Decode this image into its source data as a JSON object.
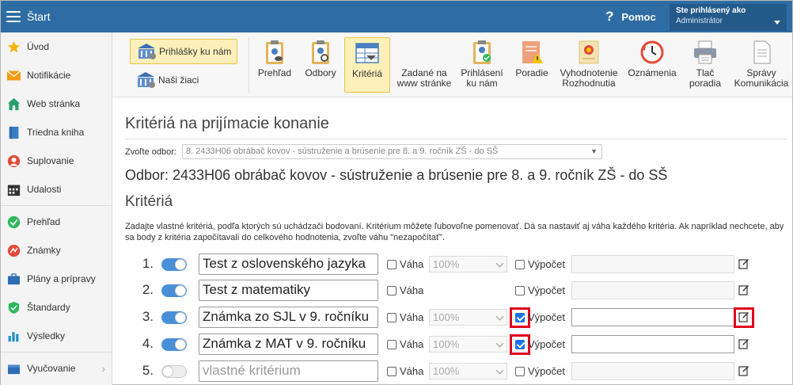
{
  "topbar": {
    "title": "Štart",
    "help_label": "Pomoc",
    "user_line1": "Ste prihlásený ako",
    "user_line2": "Administrátor"
  },
  "sidebar": {
    "items": [
      {
        "label": "Úvod",
        "icon": "star-icon"
      },
      {
        "label": "Notifikácie",
        "icon": "envelope-icon"
      },
      {
        "label": "Web stránka",
        "icon": "home-icon"
      },
      {
        "label": "Triedna kniha",
        "icon": "book-icon"
      },
      {
        "label": "Suplovanie",
        "icon": "person-icon"
      },
      {
        "label": "Udalosti",
        "icon": "calendar-icon"
      },
      {
        "label": "Prehľad",
        "icon": "check-circle-icon"
      },
      {
        "label": "Známky",
        "icon": "grade-icon"
      },
      {
        "label": "Plány a prípravy",
        "icon": "briefcase-icon"
      },
      {
        "label": "Štandardy",
        "icon": "shield-check-icon"
      },
      {
        "label": "Výsledky",
        "icon": "bar-chart-icon"
      },
      {
        "label": "Vyučovanie",
        "icon": "box-icon"
      }
    ]
  },
  "toolbar": {
    "left_buttons": [
      {
        "label": "Prihlášky ku nám",
        "icon": "building-icon",
        "active": true
      },
      {
        "label": "Naši žiaci",
        "icon": "building-icon",
        "active": false
      }
    ],
    "buttons": [
      {
        "line1": "Prehľad",
        "line2": "",
        "icon": "clipboard-eye-icon"
      },
      {
        "line1": "Odbory",
        "line2": "",
        "icon": "clipboard-search-icon"
      },
      {
        "line1": "Kritériá",
        "line2": "",
        "icon": "table-icon",
        "active": true
      },
      {
        "line1": "Zadané na",
        "line2": "www stránke",
        "icon": "text-icon"
      },
      {
        "line1": "Prihlásení",
        "line2": "ku nám",
        "icon": "clipboard-check-icon"
      },
      {
        "line1": "Poradie",
        "line2": "",
        "icon": "warning-doc-icon"
      },
      {
        "line1": "Vyhodnotenie",
        "line2": "Rozhodnutia",
        "icon": "certificate-icon"
      },
      {
        "line1": "Oznámenia",
        "line2": "",
        "icon": "clock-icon"
      },
      {
        "line1": "Tlač",
        "line2": "poradia",
        "icon": "printer-icon"
      },
      {
        "line1": "Správy",
        "line2": "Komunikácia",
        "icon": "document-icon"
      }
    ]
  },
  "main": {
    "page_title": "Kritériá na prijímacie konanie",
    "select_label": "Zvoľte odbor:",
    "select_value": "8. 2433H06 obrábač kovov - sústruženie a brúsenie pre 8. a 9. ročník ZŠ - do SŠ",
    "odbor_title": "Odbor: 2433H06 obrábač kovov - sústruženie a brúsenie pre 8. a 9. ročník ZŠ - do SŠ",
    "criteria_heading": "Kritériá",
    "description": "Zadajte vlastné kritériá, podľa ktorých sú uchádzači bodovaní. Kritérium môžete ľubovoľne pomenovať. Dá sa nastaviť aj váha každého kritéria. Ak napríklad nechcete, aby sa body z kritéria započítavali do celkového hodnotenia, zvoľte váhu \"nezapočítať\".",
    "vaha_label": "Váha",
    "vypocet_label": "Výpočet",
    "rows": [
      {
        "num": "1.",
        "enabled": true,
        "name": "Test z oslovenského jazyka",
        "placeholder": false,
        "vaha_checked": false,
        "vaha": "100%",
        "show_vaha": true,
        "vypocet_checked": false,
        "calc_enabled": false,
        "highlight_cb": false,
        "highlight_edit": false
      },
      {
        "num": "2.",
        "enabled": true,
        "name": "Test z matematiky",
        "placeholder": false,
        "vaha_checked": false,
        "vaha": "",
        "show_vaha": false,
        "vypocet_checked": false,
        "calc_enabled": false,
        "highlight_cb": false,
        "highlight_edit": false
      },
      {
        "num": "3.",
        "enabled": true,
        "name": "Známka zo SJL v 9. ročníku",
        "placeholder": false,
        "vaha_checked": false,
        "vaha": "100%",
        "show_vaha": true,
        "vypocet_checked": true,
        "calc_enabled": true,
        "highlight_cb": true,
        "highlight_edit": true
      },
      {
        "num": "4.",
        "enabled": true,
        "name": "Známka z MAT v 9. ročníku",
        "placeholder": false,
        "vaha_checked": false,
        "vaha": "100%",
        "show_vaha": true,
        "vypocet_checked": true,
        "calc_enabled": true,
        "highlight_cb": true,
        "highlight_edit": false
      },
      {
        "num": "5.",
        "enabled": false,
        "name": "vlastné kritérium",
        "placeholder": true,
        "vaha_checked": false,
        "vaha": "100%",
        "show_vaha": true,
        "vypocet_checked": false,
        "calc_enabled": false,
        "highlight_cb": false,
        "highlight_edit": false
      }
    ]
  }
}
